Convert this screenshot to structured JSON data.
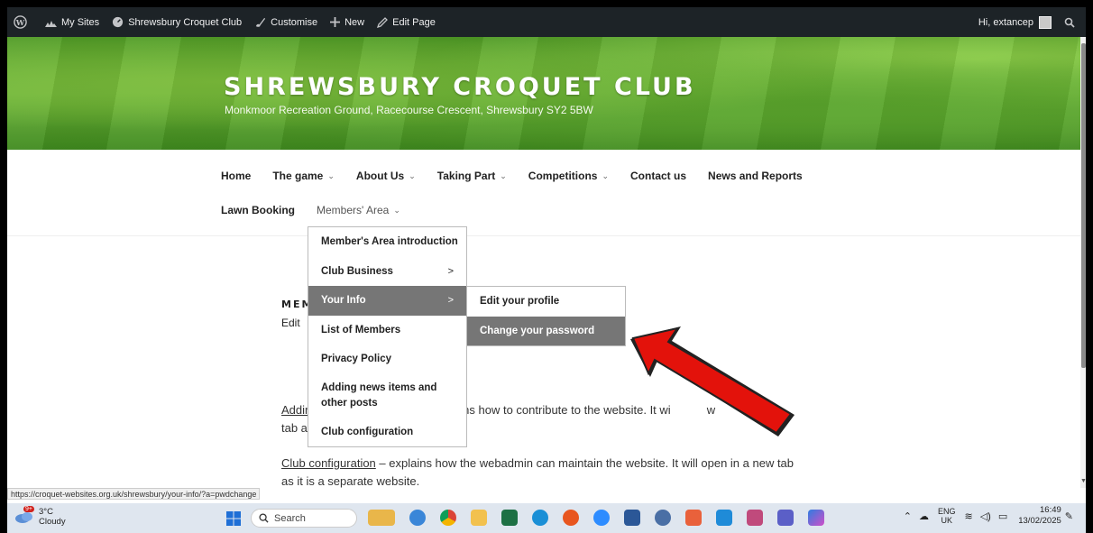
{
  "adminbar": {
    "items": [
      {
        "label": "My Sites",
        "icon": "my-sites-icon"
      },
      {
        "label": "Shrewsbury Croquet Club",
        "icon": "dashboard-icon"
      },
      {
        "label": "Customise",
        "icon": "brush-icon"
      },
      {
        "label": "New",
        "icon": "plus-icon"
      },
      {
        "label": "Edit Page",
        "icon": "pencil-icon"
      }
    ],
    "greeting": "Hi, extancep"
  },
  "header": {
    "title": "SHREWSBURY CROQUET CLUB",
    "description": "Monkmoor Recreation Ground, Racecourse Crescent, Shrewsbury SY2 5BW"
  },
  "nav": {
    "row1": [
      {
        "label": "Home",
        "has_children": false
      },
      {
        "label": "The game",
        "has_children": true
      },
      {
        "label": "About Us",
        "has_children": true
      },
      {
        "label": "Taking Part",
        "has_children": true
      },
      {
        "label": "Competitions",
        "has_children": true
      },
      {
        "label": "Contact us",
        "has_children": false
      },
      {
        "label": "News and Reports",
        "has_children": false
      }
    ],
    "row2": [
      {
        "label": "Lawn Booking",
        "has_children": false
      },
      {
        "label": "Members' Area",
        "has_children": true
      }
    ],
    "chevron": "⌄"
  },
  "dropdown": {
    "items": [
      {
        "label": "Member's Area introduction"
      },
      {
        "label": "Club Business",
        "arrow": ">"
      },
      {
        "label": "Your Info",
        "arrow": ">"
      },
      {
        "label": "List of Members"
      },
      {
        "label": "Privacy Policy"
      },
      {
        "label": "Adding news items and other posts"
      },
      {
        "label": "Club configuration"
      }
    ],
    "submenu": [
      {
        "label": "Edit your profile"
      },
      {
        "label": "Change your password"
      }
    ]
  },
  "content": {
    "page_title_visible": "MEM",
    "edit_visible": "Edit",
    "para1_link": "Addir",
    "para1_text": "– explains how to contribute to the website. It wi",
    "para1_tail": "w",
    "para1_line2": "tab a",
    "para2_link": "Club configuration",
    "para2_text": " – explains how the webadmin can maintain the website. It will open in a new tab",
    "para2_line2": "as it is a separate website."
  },
  "status_url": "https://croquet-websites.org.uk/shrewsbury/your-info/?a=pwdchange",
  "taskbar": {
    "weather_temp": "3°C",
    "weather_desc": "Cloudy",
    "weather_badge": "9+",
    "search_placeholder": "Search",
    "lang_top": "ENG",
    "lang_bottom": "UK",
    "time": "16:49",
    "date": "13/02/2025"
  },
  "colors": {
    "adminbar": "#1d2327",
    "menu_active": "#767676",
    "arrow_red": "#e3120b"
  }
}
